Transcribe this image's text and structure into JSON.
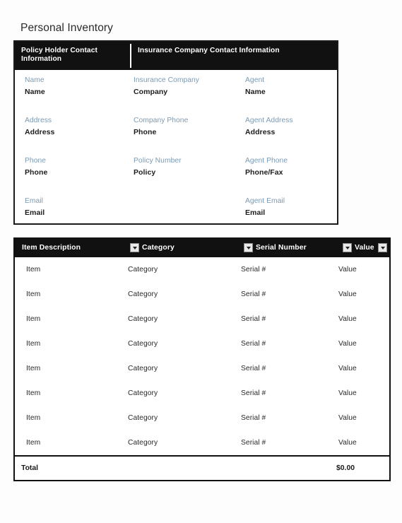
{
  "page": {
    "title": "Personal Inventory"
  },
  "contact_card": {
    "header": {
      "left": "Policy Holder Contact Information",
      "right": "Insurance Company Contact Information"
    },
    "columns": [
      {
        "name": "policy-holder",
        "fields": [
          {
            "label": "Name",
            "value": "Name"
          },
          {
            "label": "Address",
            "value": "Address"
          },
          {
            "label": "Phone",
            "value": "Phone"
          },
          {
            "label": "Email",
            "value": "Email"
          }
        ]
      },
      {
        "name": "insurance-company",
        "fields": [
          {
            "label": "Insurance Company",
            "value": "Company"
          },
          {
            "label": "Company Phone",
            "value": "Phone"
          },
          {
            "label": "Policy Number",
            "value": "Policy"
          },
          {
            "label": "",
            "value": ""
          }
        ]
      },
      {
        "name": "agent",
        "fields": [
          {
            "label": "Agent",
            "value": "Name"
          },
          {
            "label": "Agent Address",
            "value": "Address"
          },
          {
            "label": "Agent Phone",
            "value": "Phone/Fax"
          },
          {
            "label": "Agent Email",
            "value": "Email"
          }
        ]
      }
    ]
  },
  "inventory": {
    "headers": {
      "item": "Item Description",
      "category": "Category",
      "serial": "Serial Number",
      "value": "Value"
    },
    "filter_icon": "dropdown-caret-icon",
    "rows": [
      {
        "item": "Item",
        "category": "Category",
        "serial": "Serial #",
        "value": "Value"
      },
      {
        "item": "Item",
        "category": "Category",
        "serial": "Serial #",
        "value": "Value"
      },
      {
        "item": "Item",
        "category": "Category",
        "serial": "Serial #",
        "value": "Value"
      },
      {
        "item": "Item",
        "category": "Category",
        "serial": "Serial #",
        "value": "Value"
      },
      {
        "item": "Item",
        "category": "Category",
        "serial": "Serial #",
        "value": "Value"
      },
      {
        "item": "Item",
        "category": "Category",
        "serial": "Serial #",
        "value": "Value"
      },
      {
        "item": "Item",
        "category": "Category",
        "serial": "Serial #",
        "value": "Value"
      },
      {
        "item": "Item",
        "category": "Category",
        "serial": "Serial #",
        "value": "Value"
      }
    ],
    "total": {
      "label": "Total",
      "value": "$0.00"
    }
  },
  "colors": {
    "header_bg": "#111111",
    "header_text": "#ffffff",
    "field_label": "#7c9ab3",
    "field_value": "#1d1d1d",
    "page_bg": "#fdfdfd",
    "border": "#111111"
  }
}
